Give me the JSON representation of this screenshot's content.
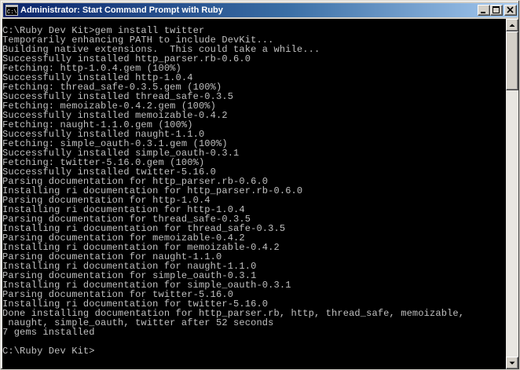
{
  "window": {
    "title": "Administrator: Start Command Prompt with Ruby",
    "icon": "cmd-icon"
  },
  "caption_buttons": {
    "minimize_icon": "minimize-icon",
    "maximize_icon": "maximize-icon",
    "close_icon": "close-icon"
  },
  "console": {
    "lines": [
      "C:\\Ruby Dev Kit>gem install twitter",
      "Temporarily enhancing PATH to include DevKit...",
      "Building native extensions.  This could take a while...",
      "Successfully installed http_parser.rb-0.6.0",
      "Fetching: http-1.0.4.gem (100%)",
      "Successfully installed http-1.0.4",
      "Fetching: thread_safe-0.3.5.gem (100%)",
      "Successfully installed thread_safe-0.3.5",
      "Fetching: memoizable-0.4.2.gem (100%)",
      "Successfully installed memoizable-0.4.2",
      "Fetching: naught-1.1.0.gem (100%)",
      "Successfully installed naught-1.1.0",
      "Fetching: simple_oauth-0.3.1.gem (100%)",
      "Successfully installed simple_oauth-0.3.1",
      "Fetching: twitter-5.16.0.gem (100%)",
      "Successfully installed twitter-5.16.0",
      "Parsing documentation for http_parser.rb-0.6.0",
      "Installing ri documentation for http_parser.rb-0.6.0",
      "Parsing documentation for http-1.0.4",
      "Installing ri documentation for http-1.0.4",
      "Parsing documentation for thread_safe-0.3.5",
      "Installing ri documentation for thread_safe-0.3.5",
      "Parsing documentation for memoizable-0.4.2",
      "Installing ri documentation for memoizable-0.4.2",
      "Parsing documentation for naught-1.1.0",
      "Installing ri documentation for naught-1.1.0",
      "Parsing documentation for simple_oauth-0.3.1",
      "Installing ri documentation for simple_oauth-0.3.1",
      "Parsing documentation for twitter-5.16.0",
      "Installing ri documentation for twitter-5.16.0",
      "Done installing documentation for http_parser.rb, http, thread_safe, memoizable,",
      " naught, simple_oauth, twitter after 52 seconds",
      "7 gems installed",
      "",
      "C:\\Ruby Dev Kit>"
    ]
  },
  "scrollbar": {
    "up_icon": "scroll-up-arrow-icon",
    "down_icon": "scroll-down-arrow-icon"
  },
  "colors": {
    "console_background": "#000000",
    "console_text": "#c0c0c0",
    "titlebar_start": "#0a246a",
    "titlebar_end": "#a6caf0",
    "chrome": "#d4d0c8"
  }
}
